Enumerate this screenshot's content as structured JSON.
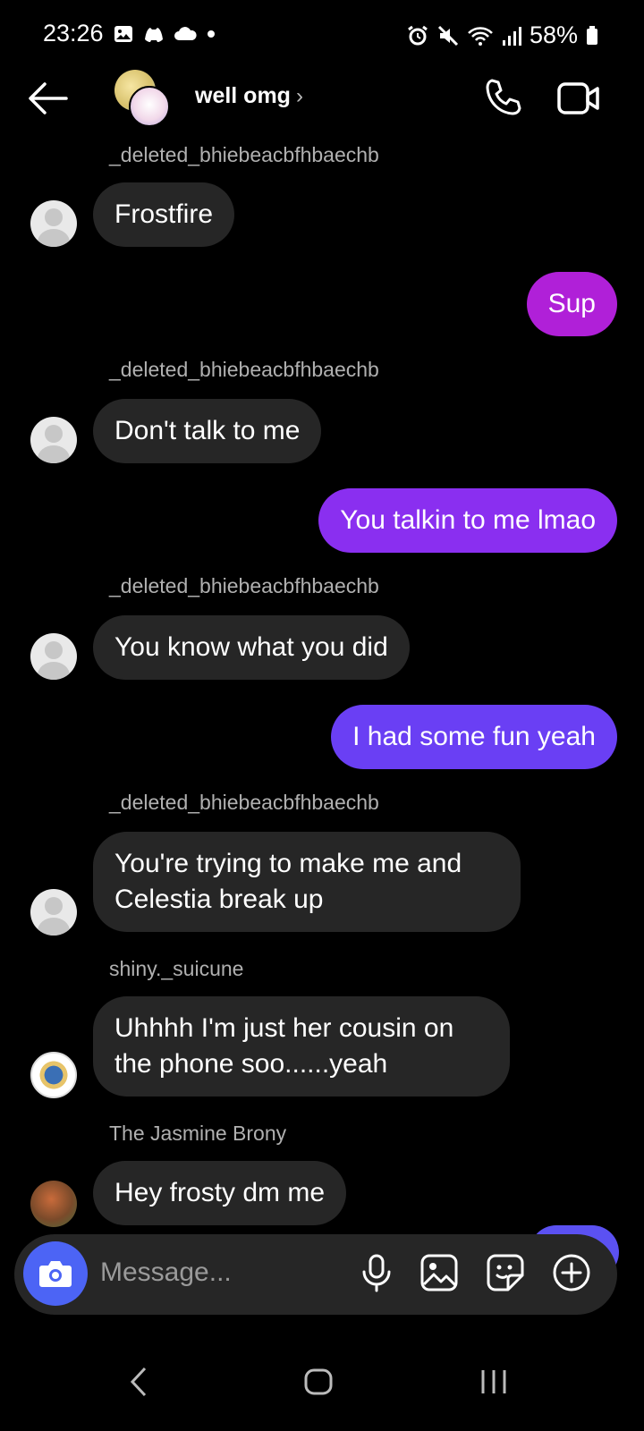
{
  "status_bar": {
    "time": "23:26",
    "battery": "58%"
  },
  "header": {
    "title": "well omg",
    "chevron": "›"
  },
  "messages": [
    {
      "sender": "_deleted_bhiebeacbfhbaechb",
      "text": "Frostfire",
      "direction": "incoming"
    },
    {
      "text": "Sup",
      "direction": "outgoing",
      "color": "#b020d8"
    },
    {
      "sender": "_deleted_bhiebeacbfhbaechb",
      "text": "Don't talk to me",
      "direction": "incoming"
    },
    {
      "text": "You talkin to me lmao",
      "direction": "outgoing",
      "color": "#8a2ff0"
    },
    {
      "sender": "_deleted_bhiebeacbfhbaechb",
      "text": "You know what you did",
      "direction": "incoming"
    },
    {
      "text": "I had some fun yeah",
      "direction": "outgoing",
      "color": "#6a3ff4"
    },
    {
      "sender": "_deleted_bhiebeacbfhbaechb",
      "text": "You're trying to make me and Celestia break up",
      "direction": "incoming"
    },
    {
      "sender": "shiny._suicune",
      "text": "Uhhhh I'm just her cousin on the phone soo......yeah",
      "direction": "incoming"
    },
    {
      "sender": "The Jasmine Brony",
      "text": "Hey frosty dm me",
      "direction": "incoming"
    }
  ],
  "composer": {
    "placeholder": "Message..."
  },
  "icons": {
    "back": "arrow-left-icon",
    "call": "phone-icon",
    "video": "video-camera-icon",
    "camera": "camera-icon",
    "mic": "microphone-icon",
    "gallery": "image-icon",
    "sticker": "sticker-icon",
    "add": "plus-circle-icon"
  },
  "colors": {
    "background": "#000000",
    "incoming_bubble": "#262626",
    "camera_button": "#4c64f5"
  }
}
